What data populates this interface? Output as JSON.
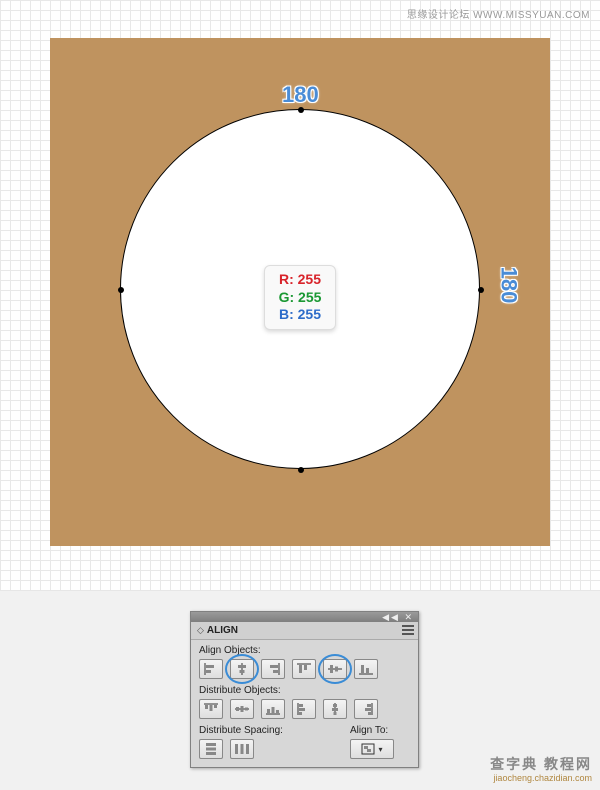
{
  "watermark_top": "思缘设计论坛 WWW.MISSYUAN.COM",
  "canvas": {
    "dim_top": "180",
    "dim_right": "180",
    "rgb": {
      "r_label": "R: 255",
      "g_label": "G: 255",
      "b_label": "B: 255"
    }
  },
  "panel": {
    "title": "ALIGN",
    "align_objects_label": "Align Objects:",
    "distribute_objects_label": "Distribute Objects:",
    "distribute_spacing_label": "Distribute Spacing:",
    "align_to_label": "Align To:"
  },
  "watermark_bottom": {
    "main": "查字典 教程网",
    "sub": "jiaocheng.chazidian.com"
  }
}
